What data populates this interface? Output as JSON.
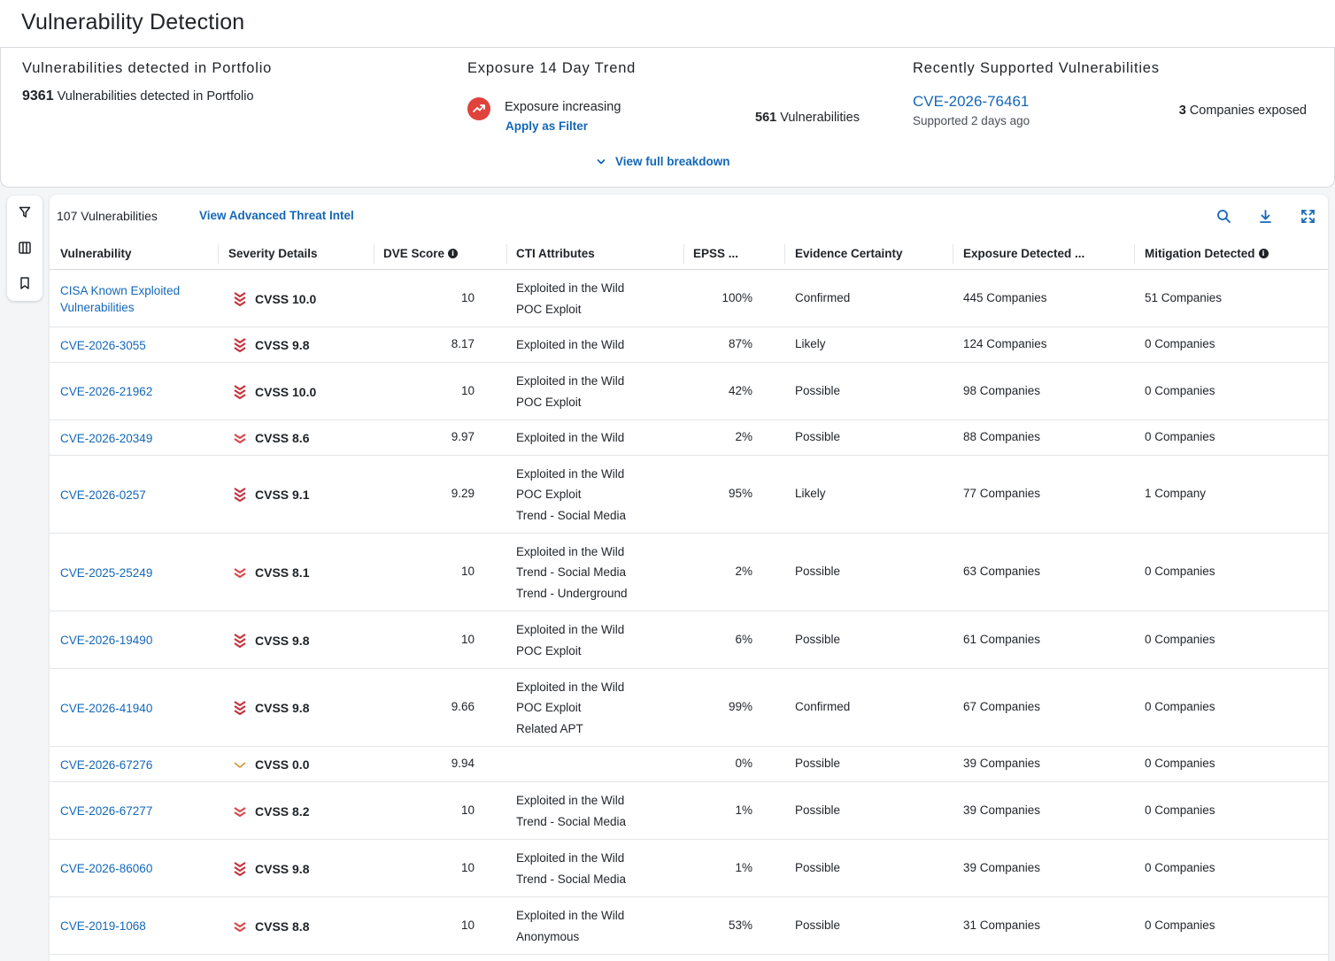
{
  "header": {
    "title": "Vulnerability Detection"
  },
  "summary": {
    "portfolio": {
      "title": "Vulnerabilities detected in Portfolio",
      "count": "9361",
      "count_label": "Vulnerabilities detected in Portfolio"
    },
    "trend": {
      "title": "Exposure 14 Day Trend",
      "status": "Exposure increasing",
      "apply_filter": "Apply as Filter",
      "vuln_count": "561",
      "vuln_label": "Vulnerabilities",
      "breakdown": "View full breakdown"
    },
    "recent": {
      "title": "Recently Supported Vulnerabilities",
      "cve": "CVE-2026-76461",
      "supported": "Supported 2 days ago",
      "companies_count": "3",
      "companies_label": "Companies exposed"
    }
  },
  "toolbar": {
    "count_label": "107 Vulnerabilities",
    "intel_link": "View Advanced Threat Intel"
  },
  "columns": {
    "vulnerability": "Vulnerability",
    "severity": "Severity Details",
    "dve": "DVE Score",
    "cti": "CTI Attributes",
    "epss": "EPSS ...",
    "evidence": "Evidence Certainty",
    "exposure": "Exposure Detected ...",
    "mitigation": "Mitigation Detected"
  },
  "colors": {
    "link": "#1467b8",
    "critical": "#c6323a",
    "high": "#d9474b",
    "low": "#d9922e",
    "trend": "#e0423c"
  },
  "rows": [
    {
      "vuln": "CISA Known Exploited Vulnerabilities",
      "sev": "CVSS 10.0",
      "sev_level": "critical",
      "dve": "10",
      "cti": [
        "Exploited in the Wild",
        "POC Exploit"
      ],
      "epss": "100%",
      "evid": "Confirmed",
      "expo": "445 Companies",
      "miti": "51 Companies"
    },
    {
      "vuln": "CVE-2026-3055",
      "sev": "CVSS 9.8",
      "sev_level": "critical",
      "dve": "8.17",
      "cti": [
        "Exploited in the Wild"
      ],
      "epss": "87%",
      "evid": "Likely",
      "expo": "124 Companies",
      "miti": "0 Companies"
    },
    {
      "vuln": "CVE-2026-21962",
      "sev": "CVSS 10.0",
      "sev_level": "critical",
      "dve": "10",
      "cti": [
        "Exploited in the Wild",
        "POC Exploit"
      ],
      "epss": "42%",
      "evid": "Possible",
      "expo": "98 Companies",
      "miti": "0 Companies"
    },
    {
      "vuln": "CVE-2026-20349",
      "sev": "CVSS 8.6",
      "sev_level": "high",
      "dve": "9.97",
      "cti": [
        "Exploited in the Wild"
      ],
      "epss": "2%",
      "evid": "Possible",
      "expo": "88 Companies",
      "miti": "0 Companies"
    },
    {
      "vuln": "CVE-2026-0257",
      "sev": "CVSS 9.1",
      "sev_level": "critical",
      "dve": "9.29",
      "cti": [
        "Exploited in the Wild",
        "POC Exploit",
        "Trend - Social Media"
      ],
      "epss": "95%",
      "evid": "Likely",
      "expo": "77 Companies",
      "miti": "1 Company"
    },
    {
      "vuln": "CVE-2025-25249",
      "sev": "CVSS 8.1",
      "sev_level": "high",
      "dve": "10",
      "cti": [
        "Exploited in the Wild",
        "Trend - Social Media",
        "Trend - Underground"
      ],
      "epss": "2%",
      "evid": "Possible",
      "expo": "63 Companies",
      "miti": "0 Companies"
    },
    {
      "vuln": "CVE-2026-19490",
      "sev": "CVSS 9.8",
      "sev_level": "critical",
      "dve": "10",
      "cti": [
        "Exploited in the Wild",
        "POC Exploit"
      ],
      "epss": "6%",
      "evid": "Possible",
      "expo": "61 Companies",
      "miti": "0 Companies"
    },
    {
      "vuln": "CVE-2026-41940",
      "sev": "CVSS 9.8",
      "sev_level": "critical",
      "dve": "9.66",
      "cti": [
        "Exploited in the Wild",
        "POC Exploit",
        "Related APT"
      ],
      "epss": "99%",
      "evid": "Confirmed",
      "expo": "67 Companies",
      "miti": "0 Companies"
    },
    {
      "vuln": "CVE-2026-67276",
      "sev": "CVSS 0.0",
      "sev_level": "low",
      "dve": "9.94",
      "cti": [],
      "epss": "0%",
      "evid": "Possible",
      "expo": "39 Companies",
      "miti": "0 Companies"
    },
    {
      "vuln": "CVE-2026-67277",
      "sev": "CVSS 8.2",
      "sev_level": "high",
      "dve": "10",
      "cti": [
        "Exploited in the Wild",
        "Trend - Social Media"
      ],
      "epss": "1%",
      "evid": "Possible",
      "expo": "39 Companies",
      "miti": "0 Companies"
    },
    {
      "vuln": "CVE-2026-86060",
      "sev": "CVSS 9.8",
      "sev_level": "critical",
      "dve": "10",
      "cti": [
        "Exploited in the Wild",
        "Trend - Social Media"
      ],
      "epss": "1%",
      "evid": "Possible",
      "expo": "39 Companies",
      "miti": "0 Companies"
    },
    {
      "vuln": "CVE-2019-1068",
      "sev": "CVSS 8.8",
      "sev_level": "high",
      "dve": "10",
      "cti": [
        "Exploited in the Wild",
        "Anonymous"
      ],
      "epss": "53%",
      "evid": "Possible",
      "expo": "31 Companies",
      "miti": "0 Companies"
    }
  ]
}
